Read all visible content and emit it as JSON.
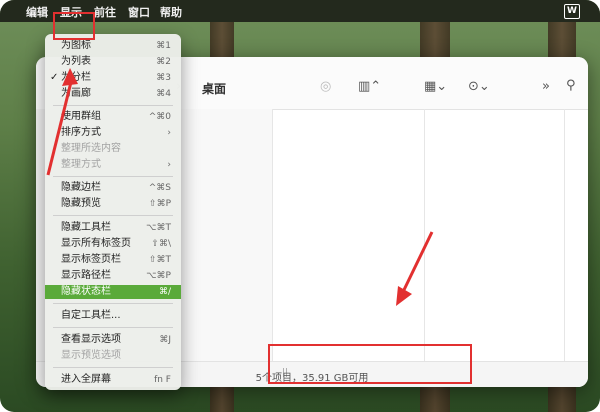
{
  "menubar": {
    "items": [
      "编辑",
      "显示",
      "前往",
      "窗口",
      "帮助"
    ]
  },
  "finder": {
    "title": "桌面",
    "status": "5个项目，35.91 GB可用"
  },
  "menu": {
    "items": [
      {
        "label": "为图标",
        "shortcut": "⌘1",
        "disabled": false,
        "checked": false,
        "selected": false
      },
      {
        "label": "为列表",
        "shortcut": "⌘2",
        "disabled": false,
        "checked": false,
        "selected": false
      },
      {
        "label": "为分栏",
        "shortcut": "⌘3",
        "disabled": false,
        "checked": true,
        "selected": false
      },
      {
        "label": "为画廊",
        "shortcut": "⌘4",
        "disabled": false,
        "checked": false,
        "selected": false
      },
      {
        "label": "使用群组",
        "shortcut": "^⌘0",
        "disabled": false,
        "checked": false,
        "selected": false
      },
      {
        "label": "排序方式",
        "shortcut": "›",
        "disabled": false,
        "checked": false,
        "selected": false
      },
      {
        "label": "整理所选内容",
        "shortcut": "",
        "disabled": true,
        "checked": false,
        "selected": false
      },
      {
        "label": "整理方式",
        "shortcut": "›",
        "disabled": true,
        "checked": false,
        "selected": false
      },
      {
        "label": "隐藏边栏",
        "shortcut": "^⌘S",
        "disabled": false,
        "checked": false,
        "selected": false
      },
      {
        "label": "隐藏预览",
        "shortcut": "⇧⌘P",
        "disabled": false,
        "checked": false,
        "selected": false
      },
      {
        "label": "隐藏工具栏",
        "shortcut": "⌥⌘T",
        "disabled": false,
        "checked": false,
        "selected": false
      },
      {
        "label": "显示所有标签页",
        "shortcut": "⇧⌘\\",
        "disabled": false,
        "checked": false,
        "selected": false
      },
      {
        "label": "显示标签页栏",
        "shortcut": "⇧⌘T",
        "disabled": false,
        "checked": false,
        "selected": false
      },
      {
        "label": "显示路径栏",
        "shortcut": "⌥⌘P",
        "disabled": false,
        "checked": false,
        "selected": false
      },
      {
        "label": "隐藏状态栏",
        "shortcut": "⌘/",
        "disabled": false,
        "checked": false,
        "selected": true
      },
      {
        "label": "自定工具栏...",
        "shortcut": "",
        "disabled": false,
        "checked": false,
        "selected": false
      },
      {
        "label": "查看显示选项",
        "shortcut": "⌘J",
        "disabled": false,
        "checked": false,
        "selected": false
      },
      {
        "label": "显示预览选项",
        "shortcut": "",
        "disabled": true,
        "checked": false,
        "selected": false
      },
      {
        "label": "进入全屏幕",
        "shortcut": "fn F",
        "disabled": false,
        "checked": false,
        "selected": false
      }
    ]
  },
  "colors": {
    "accent": "#5aaa3a",
    "annotation": "#e23030"
  }
}
